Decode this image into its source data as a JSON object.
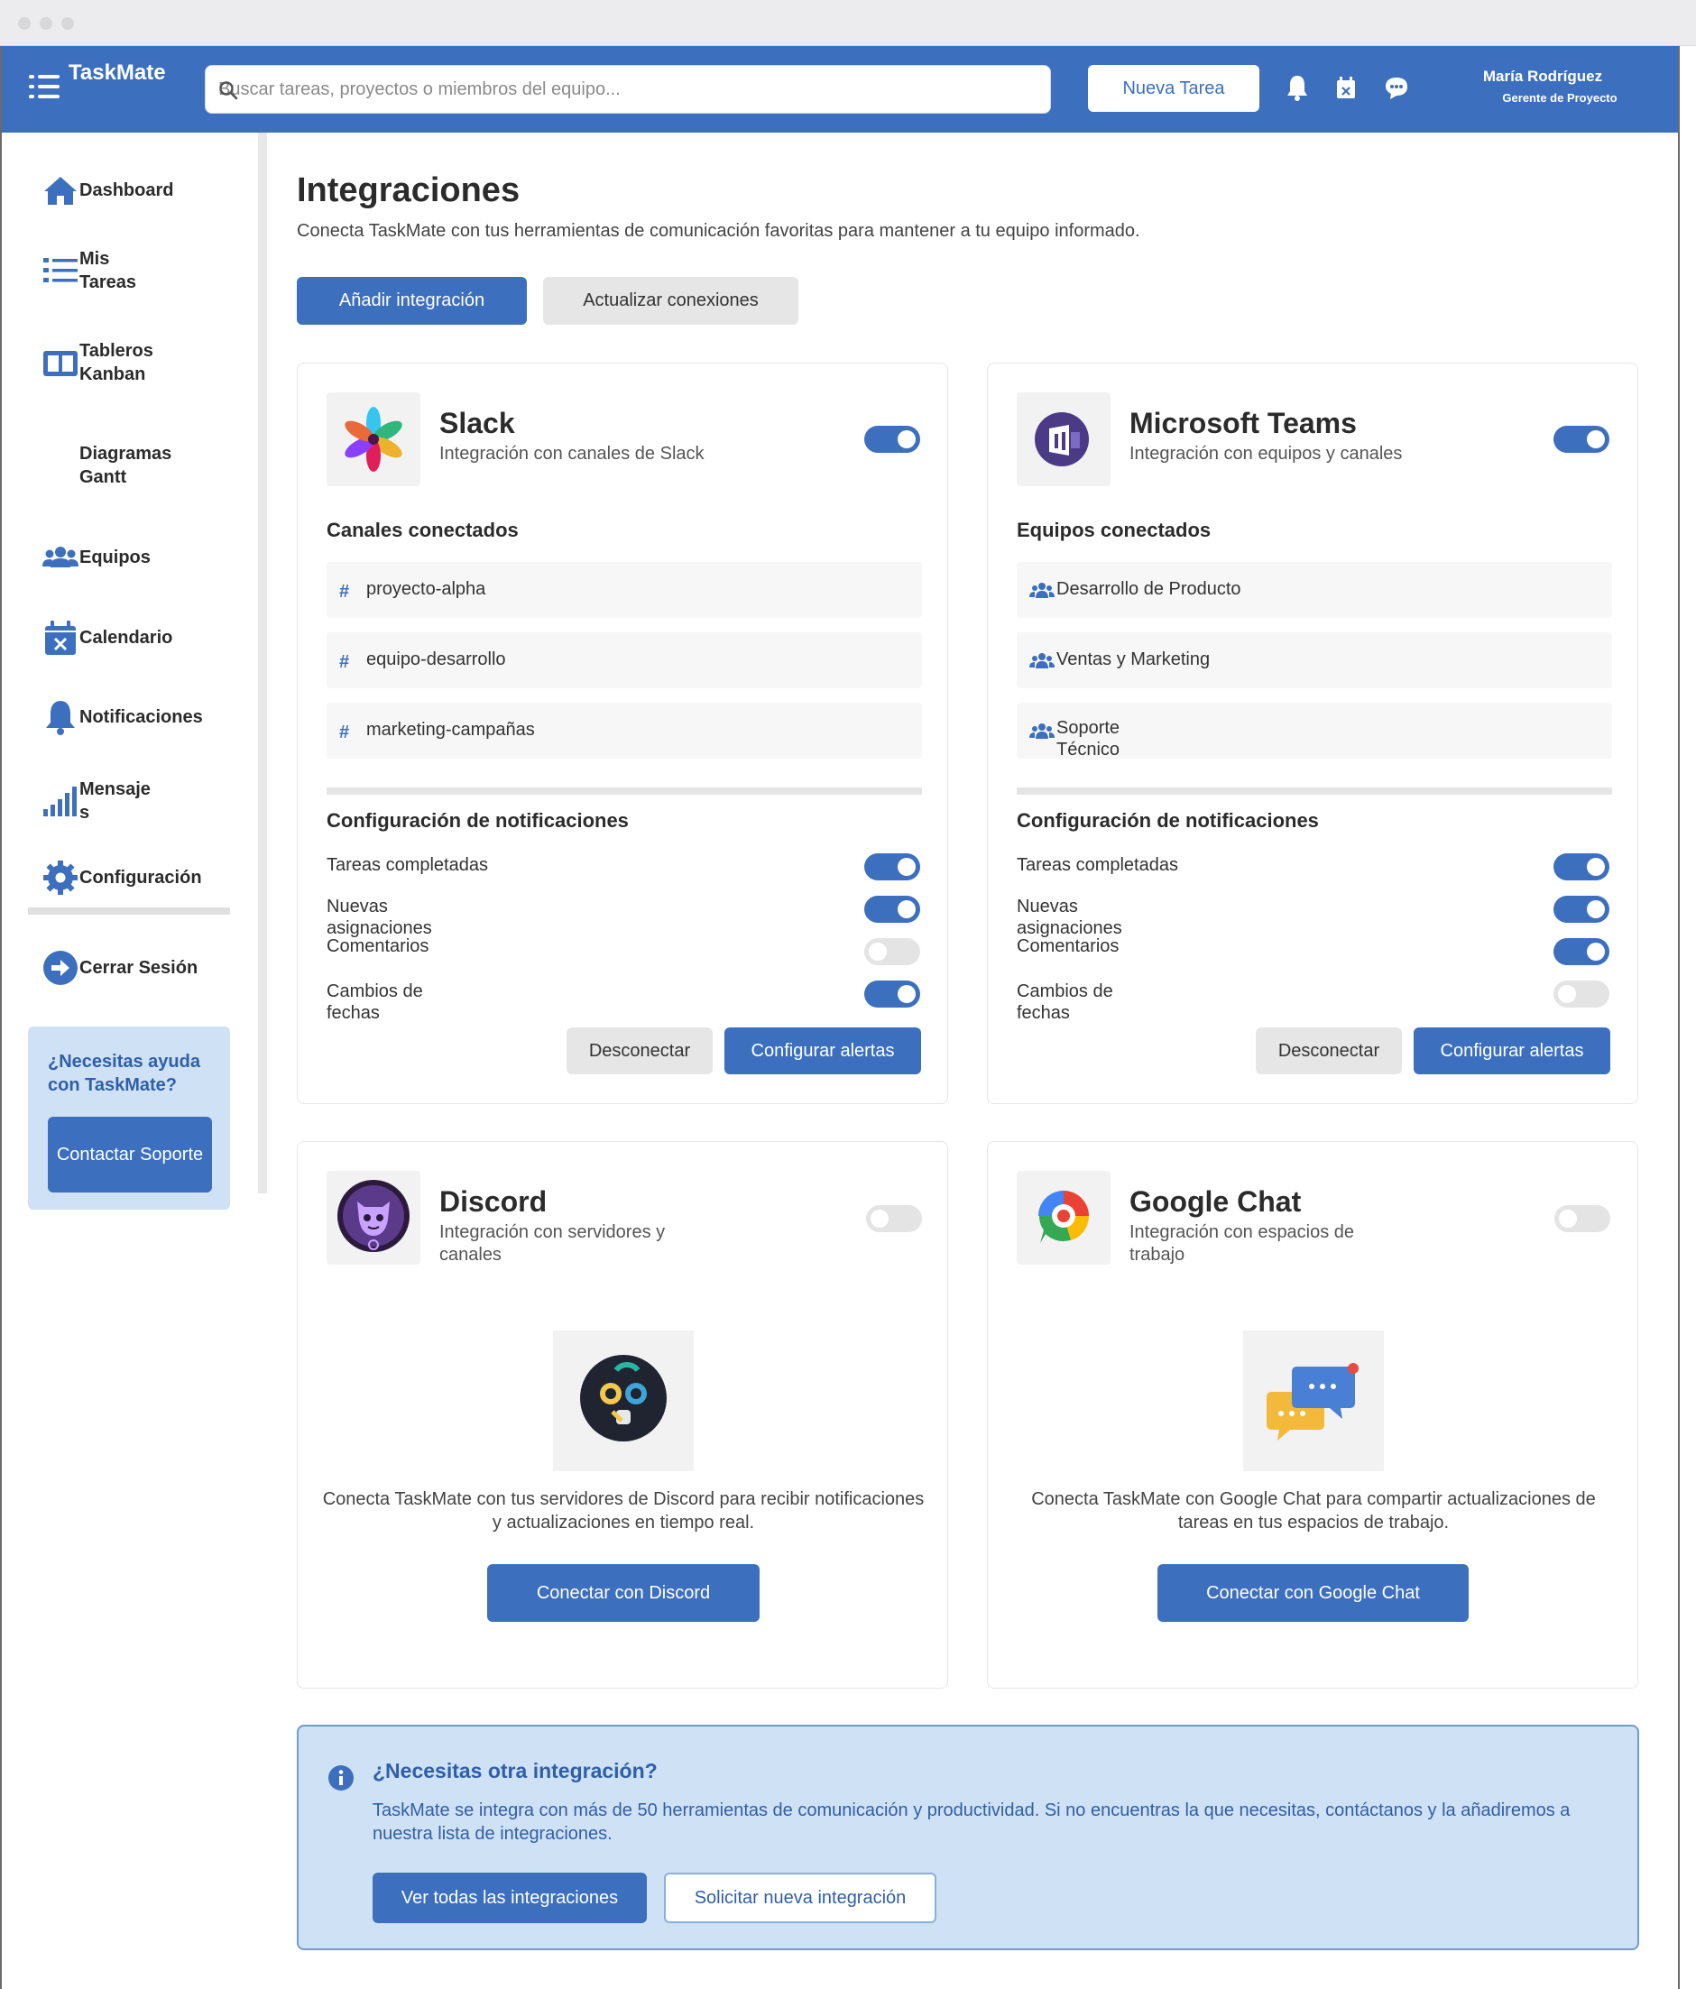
{
  "header": {
    "app_name": "TaskMate",
    "search_placeholder": "Buscar tareas, proyectos o miembros del equipo...",
    "new_task_label": "Nueva Tarea",
    "user_name": "María Rodríguez",
    "user_role": "Gerente de Proyecto"
  },
  "sidebar": {
    "items": [
      {
        "label": "Dashboard",
        "icon": "home-icon"
      },
      {
        "label": "Mis Tareas",
        "icon": "list-icon"
      },
      {
        "label": "Tableros Kanban",
        "icon": "kanban-icon"
      },
      {
        "label": "Diagramas Gantt",
        "icon": ""
      },
      {
        "label": "Equipos",
        "icon": "team-icon"
      },
      {
        "label": "Calendario",
        "icon": "calendar-icon"
      },
      {
        "label": "Notificaciones",
        "icon": "bell-icon"
      },
      {
        "label": "Mensajes",
        "icon": "signal-icon"
      },
      {
        "label": "Configuración",
        "icon": "gear-icon"
      },
      {
        "label": "Cerrar Sesión",
        "icon": "logout-icon"
      }
    ],
    "help_title": "¿Necesitas ayuda con TaskMate?",
    "help_button": "Contactar Soporte"
  },
  "page": {
    "title": "Integraciones",
    "subtitle": "Conecta TaskMate con tus herramientas de comunicación favoritas para mantener a tu equipo informado.",
    "add_button": "Añadir integración",
    "refresh_button": "Actualizar conexiones"
  },
  "cards": {
    "slack": {
      "name": "Slack",
      "description": "Integración con canales de Slack",
      "enabled": true,
      "section_title": "Canales conectados",
      "items": [
        "proyecto-alpha",
        "equipo-desarrollo",
        "marketing-campañas"
      ],
      "notif_title": "Configuración de notificaciones",
      "notifications": [
        {
          "label": "Tareas completadas",
          "on": true
        },
        {
          "label": "Nuevas asignaciones",
          "on": true
        },
        {
          "label": "Comentarios",
          "on": false
        },
        {
          "label": "Cambios de fechas",
          "on": true
        }
      ],
      "disconnect": "Desconectar",
      "configure": "Configurar alertas"
    },
    "teams": {
      "name": "Microsoft Teams",
      "description": "Integración con equipos y canales",
      "enabled": true,
      "section_title": "Equipos conectados",
      "items": [
        "Desarrollo de Producto",
        "Ventas y Marketing",
        "Soporte Técnico"
      ],
      "notif_title": "Configuración de notificaciones",
      "notifications": [
        {
          "label": "Tareas completadas",
          "on": true
        },
        {
          "label": "Nuevas asignaciones",
          "on": true
        },
        {
          "label": "Comentarios",
          "on": true
        },
        {
          "label": "Cambios de fechas",
          "on": false
        }
      ],
      "disconnect": "Desconectar",
      "configure": "Configurar alertas"
    },
    "discord": {
      "name": "Discord",
      "description": "Integración con servidores y canales",
      "enabled": false,
      "text": "Conecta TaskMate con tus servidores de Discord para recibir notificaciones y actualizaciones en tiempo real.",
      "button": "Conectar con Discord"
    },
    "gchat": {
      "name": "Google Chat",
      "description": "Integración con espacios de trabajo",
      "enabled": false,
      "text": "Conecta TaskMate con Google Chat para compartir actualizaciones de tareas en tus espacios de trabajo.",
      "button": "Conectar con Google Chat"
    }
  },
  "info": {
    "title": "¿Necesitas otra integración?",
    "text": "TaskMate se integra con más de 50 herramientas de comunicación y productividad. Si no encuentras la que necesitas, contáctanos y la añadiremos a nuestra lista de integraciones.",
    "view_all": "Ver todas las integraciones",
    "request": "Solicitar nueva integración"
  },
  "colors": {
    "primary": "#3d6fbf",
    "info_bg": "#cfe1f5",
    "info_text": "#2e5fa9",
    "toggle_off": "#e4e4e4"
  }
}
